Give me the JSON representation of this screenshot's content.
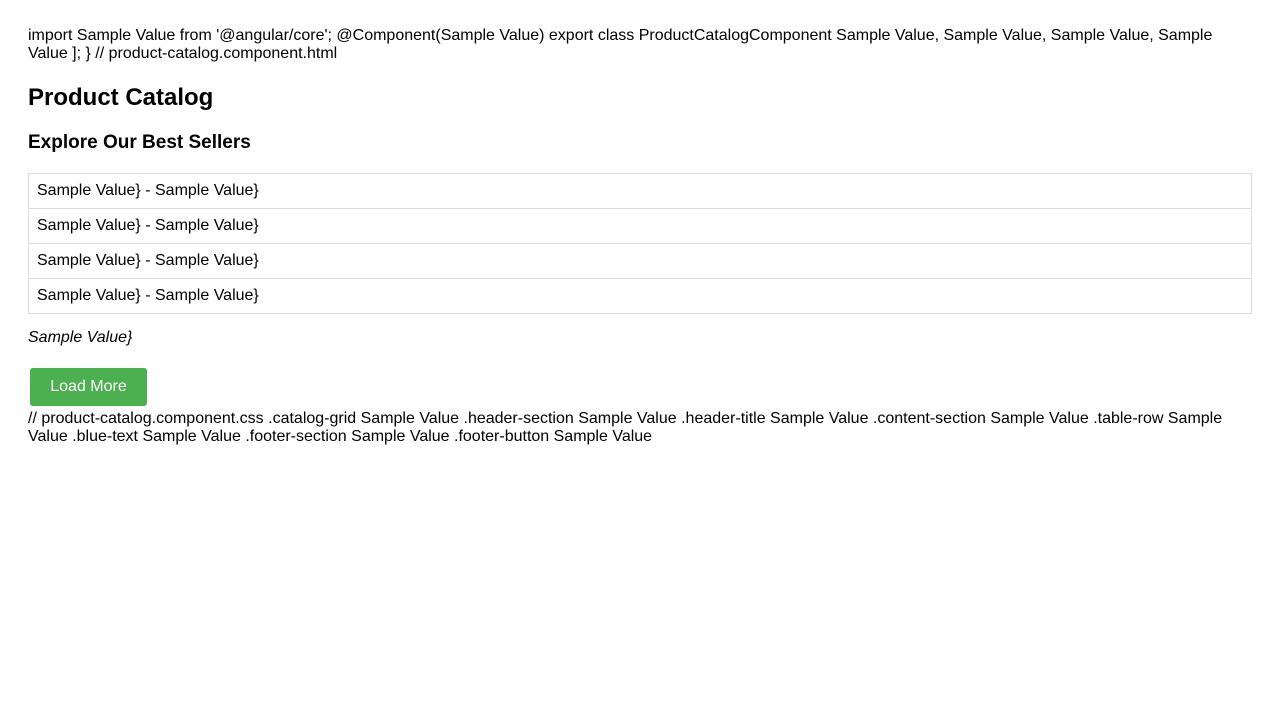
{
  "code_header": "import Sample Value from '@angular/core'; @Component(Sample Value) export class ProductCatalogComponent Sample Value, Sample Value, Sample Value, Sample Value ]; } // product-catalog.component.html",
  "header": {
    "title": "Product Catalog"
  },
  "content": {
    "subtitle": "Explore Our Best Sellers",
    "rows": [
      {
        "text": "Sample Value} - Sample Value}"
      },
      {
        "text": "Sample Value} - Sample Value}"
      },
      {
        "text": "Sample Value} - Sample Value}"
      },
      {
        "text": "Sample Value} - Sample Value}"
      }
    ],
    "note": "Sample Value}"
  },
  "footer": {
    "button_label": "Load More",
    "button_color": "#4caf50"
  },
  "css_footer": "// product-catalog.component.css .catalog-grid Sample Value .header-section Sample Value .header-title Sample Value .content-section Sample Value .table-row Sample Value .blue-text Sample Value .footer-section Sample Value .footer-button Sample Value"
}
